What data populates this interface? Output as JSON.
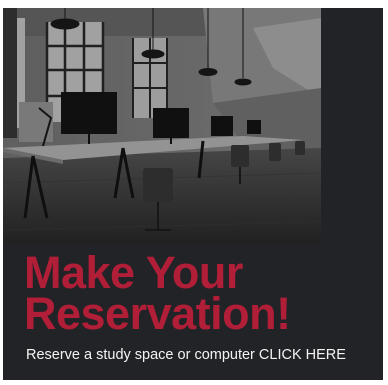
{
  "banner": {
    "headline_line1": "Make Your",
    "headline_line2": "Reservation!",
    "cta_text": "Reserve a study space or computer CLICK HERE",
    "photo_subject": "grayscale office with rows of desks, computer monitors, chairs and pendant lamps",
    "colors": {
      "background": "#222326",
      "headline": "#b01e37",
      "cta": "#f4f4f4"
    }
  }
}
